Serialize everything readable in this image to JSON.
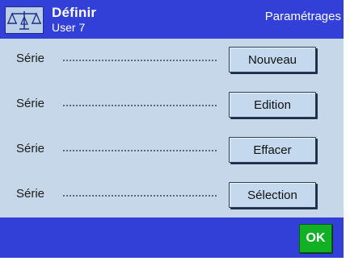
{
  "header": {
    "title": "Définir",
    "subtitle": "User 7",
    "section": "Paramétrages",
    "icon": "balance-scale-icon"
  },
  "rows": [
    {
      "label": "Série",
      "button": "Nouveau"
    },
    {
      "label": "Série",
      "button": "Edition"
    },
    {
      "label": "Série",
      "button": "Effacer"
    },
    {
      "label": "Série",
      "button": "Sélection"
    }
  ],
  "footer": {
    "ok_label": "OK"
  },
  "colors": {
    "header_bg": "#3240d8",
    "screen_bg": "#c6d7ea",
    "ok_green": "#12b024"
  }
}
